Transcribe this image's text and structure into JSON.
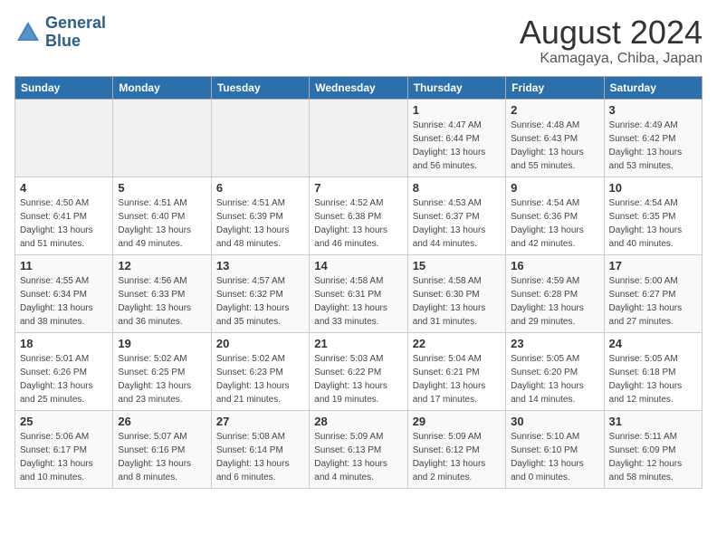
{
  "header": {
    "logo_line1": "General",
    "logo_line2": "Blue",
    "month_year": "August 2024",
    "location": "Kamagaya, Chiba, Japan"
  },
  "weekdays": [
    "Sunday",
    "Monday",
    "Tuesday",
    "Wednesday",
    "Thursday",
    "Friday",
    "Saturday"
  ],
  "weeks": [
    [
      {
        "day": "",
        "info": ""
      },
      {
        "day": "",
        "info": ""
      },
      {
        "day": "",
        "info": ""
      },
      {
        "day": "",
        "info": ""
      },
      {
        "day": "1",
        "info": "Sunrise: 4:47 AM\nSunset: 6:44 PM\nDaylight: 13 hours\nand 56 minutes."
      },
      {
        "day": "2",
        "info": "Sunrise: 4:48 AM\nSunset: 6:43 PM\nDaylight: 13 hours\nand 55 minutes."
      },
      {
        "day": "3",
        "info": "Sunrise: 4:49 AM\nSunset: 6:42 PM\nDaylight: 13 hours\nand 53 minutes."
      }
    ],
    [
      {
        "day": "4",
        "info": "Sunrise: 4:50 AM\nSunset: 6:41 PM\nDaylight: 13 hours\nand 51 minutes."
      },
      {
        "day": "5",
        "info": "Sunrise: 4:51 AM\nSunset: 6:40 PM\nDaylight: 13 hours\nand 49 minutes."
      },
      {
        "day": "6",
        "info": "Sunrise: 4:51 AM\nSunset: 6:39 PM\nDaylight: 13 hours\nand 48 minutes."
      },
      {
        "day": "7",
        "info": "Sunrise: 4:52 AM\nSunset: 6:38 PM\nDaylight: 13 hours\nand 46 minutes."
      },
      {
        "day": "8",
        "info": "Sunrise: 4:53 AM\nSunset: 6:37 PM\nDaylight: 13 hours\nand 44 minutes."
      },
      {
        "day": "9",
        "info": "Sunrise: 4:54 AM\nSunset: 6:36 PM\nDaylight: 13 hours\nand 42 minutes."
      },
      {
        "day": "10",
        "info": "Sunrise: 4:54 AM\nSunset: 6:35 PM\nDaylight: 13 hours\nand 40 minutes."
      }
    ],
    [
      {
        "day": "11",
        "info": "Sunrise: 4:55 AM\nSunset: 6:34 PM\nDaylight: 13 hours\nand 38 minutes."
      },
      {
        "day": "12",
        "info": "Sunrise: 4:56 AM\nSunset: 6:33 PM\nDaylight: 13 hours\nand 36 minutes."
      },
      {
        "day": "13",
        "info": "Sunrise: 4:57 AM\nSunset: 6:32 PM\nDaylight: 13 hours\nand 35 minutes."
      },
      {
        "day": "14",
        "info": "Sunrise: 4:58 AM\nSunset: 6:31 PM\nDaylight: 13 hours\nand 33 minutes."
      },
      {
        "day": "15",
        "info": "Sunrise: 4:58 AM\nSunset: 6:30 PM\nDaylight: 13 hours\nand 31 minutes."
      },
      {
        "day": "16",
        "info": "Sunrise: 4:59 AM\nSunset: 6:28 PM\nDaylight: 13 hours\nand 29 minutes."
      },
      {
        "day": "17",
        "info": "Sunrise: 5:00 AM\nSunset: 6:27 PM\nDaylight: 13 hours\nand 27 minutes."
      }
    ],
    [
      {
        "day": "18",
        "info": "Sunrise: 5:01 AM\nSunset: 6:26 PM\nDaylight: 13 hours\nand 25 minutes."
      },
      {
        "day": "19",
        "info": "Sunrise: 5:02 AM\nSunset: 6:25 PM\nDaylight: 13 hours\nand 23 minutes."
      },
      {
        "day": "20",
        "info": "Sunrise: 5:02 AM\nSunset: 6:23 PM\nDaylight: 13 hours\nand 21 minutes."
      },
      {
        "day": "21",
        "info": "Sunrise: 5:03 AM\nSunset: 6:22 PM\nDaylight: 13 hours\nand 19 minutes."
      },
      {
        "day": "22",
        "info": "Sunrise: 5:04 AM\nSunset: 6:21 PM\nDaylight: 13 hours\nand 17 minutes."
      },
      {
        "day": "23",
        "info": "Sunrise: 5:05 AM\nSunset: 6:20 PM\nDaylight: 13 hours\nand 14 minutes."
      },
      {
        "day": "24",
        "info": "Sunrise: 5:05 AM\nSunset: 6:18 PM\nDaylight: 13 hours\nand 12 minutes."
      }
    ],
    [
      {
        "day": "25",
        "info": "Sunrise: 5:06 AM\nSunset: 6:17 PM\nDaylight: 13 hours\nand 10 minutes."
      },
      {
        "day": "26",
        "info": "Sunrise: 5:07 AM\nSunset: 6:16 PM\nDaylight: 13 hours\nand 8 minutes."
      },
      {
        "day": "27",
        "info": "Sunrise: 5:08 AM\nSunset: 6:14 PM\nDaylight: 13 hours\nand 6 minutes."
      },
      {
        "day": "28",
        "info": "Sunrise: 5:09 AM\nSunset: 6:13 PM\nDaylight: 13 hours\nand 4 minutes."
      },
      {
        "day": "29",
        "info": "Sunrise: 5:09 AM\nSunset: 6:12 PM\nDaylight: 13 hours\nand 2 minutes."
      },
      {
        "day": "30",
        "info": "Sunrise: 5:10 AM\nSunset: 6:10 PM\nDaylight: 13 hours\nand 0 minutes."
      },
      {
        "day": "31",
        "info": "Sunrise: 5:11 AM\nSunset: 6:09 PM\nDaylight: 12 hours\nand 58 minutes."
      }
    ]
  ]
}
